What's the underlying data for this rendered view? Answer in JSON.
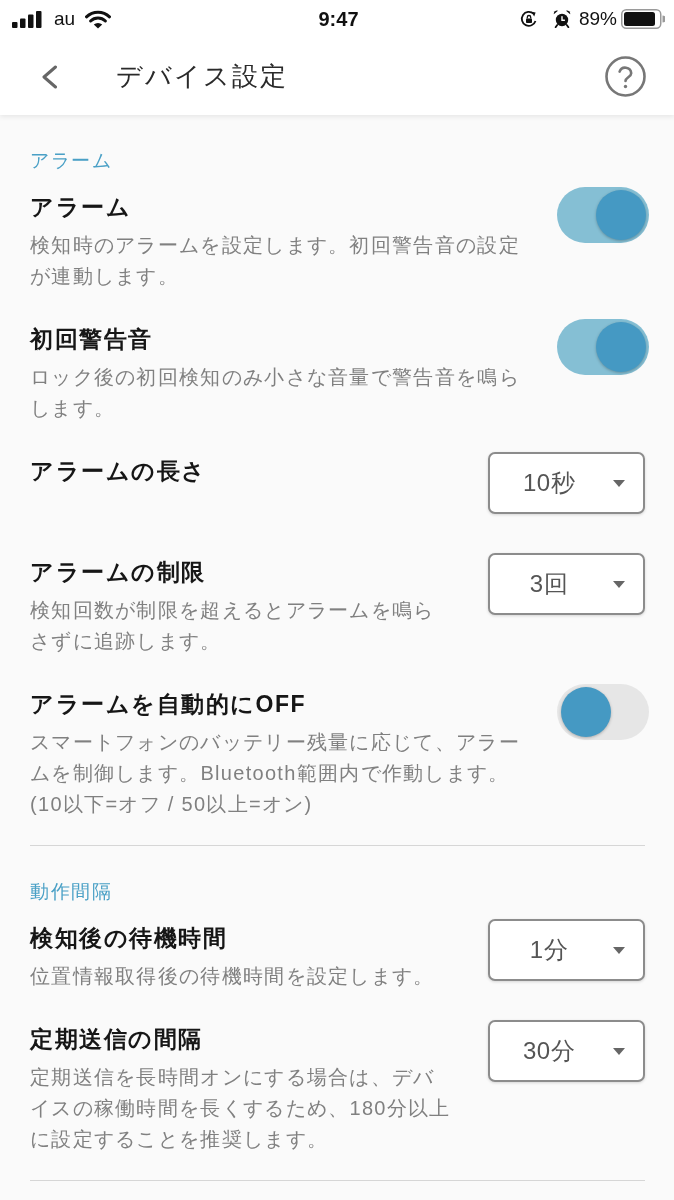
{
  "status_bar": {
    "carrier": "au",
    "time": "9:47",
    "battery": "89%"
  },
  "header": {
    "title": "デバイス設定"
  },
  "sections": [
    {
      "title": "アラーム",
      "items": [
        {
          "kind": "toggle",
          "label": "アラーム",
          "description": "検知時のアラームを設定します。初回警告音の設定が連動します。",
          "on": true
        },
        {
          "kind": "toggle",
          "label": "初回警告音",
          "description": "ロック後の初回検知のみ小さな音量で警告音を鳴らします。",
          "on": true
        },
        {
          "kind": "dropdown",
          "label": "アラームの長さ",
          "value": "10秒"
        },
        {
          "kind": "dropdown",
          "label": "アラームの制限",
          "description": "検知回数が制限を超えるとアラームを鳴らさずに追跡します。",
          "value": "3回"
        },
        {
          "kind": "toggle",
          "label": "アラームを自動的にOFF",
          "description": "スマートフォンのバッテリー残量に応じて、アラームを制御します。Bluetooth範囲内で作動します。(10以下=オフ / 50以上=オン)",
          "on": false
        }
      ]
    },
    {
      "title": "動作間隔",
      "items": [
        {
          "kind": "dropdown",
          "label": "検知後の待機時間",
          "description": "位置情報取得後の待機時間を設定します。",
          "value": "1分"
        },
        {
          "kind": "dropdown",
          "label": "定期送信の間隔",
          "description": "定期送信を長時間オンにする場合は、デバイスの稼働時間を長くするため、180分以上に設定することを推奨します。",
          "value": "30分"
        }
      ]
    }
  ]
}
